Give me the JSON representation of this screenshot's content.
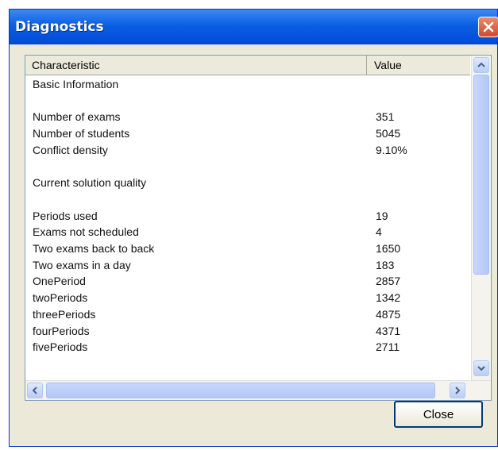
{
  "window": {
    "title": "Diagnostics"
  },
  "columns": {
    "characteristic": "Characteristic",
    "value": "Value"
  },
  "rows": [
    {
      "name": "Basic Information",
      "value": ""
    },
    {
      "name": "",
      "value": ""
    },
    {
      "name": "Number of exams",
      "value": "351"
    },
    {
      "name": "Number of students",
      "value": "5045"
    },
    {
      "name": "Conflict density",
      "value": "9.10%"
    },
    {
      "name": "",
      "value": ""
    },
    {
      "name": "Current solution quality",
      "value": ""
    },
    {
      "name": "",
      "value": ""
    },
    {
      "name": "Periods used",
      "value": "19"
    },
    {
      "name": "Exams not scheduled",
      "value": "4"
    },
    {
      "name": "Two exams back to back",
      "value": "1650"
    },
    {
      "name": "Two exams in a day",
      "value": "183"
    },
    {
      "name": "OnePeriod",
      "value": "2857"
    },
    {
      "name": "twoPeriods",
      "value": "1342"
    },
    {
      "name": "threePeriods",
      "value": "4875"
    },
    {
      "name": "fourPeriods",
      "value": "4371"
    },
    {
      "name": "fivePeriods",
      "value": "2711"
    }
  ],
  "buttons": {
    "close_label": "Close"
  }
}
